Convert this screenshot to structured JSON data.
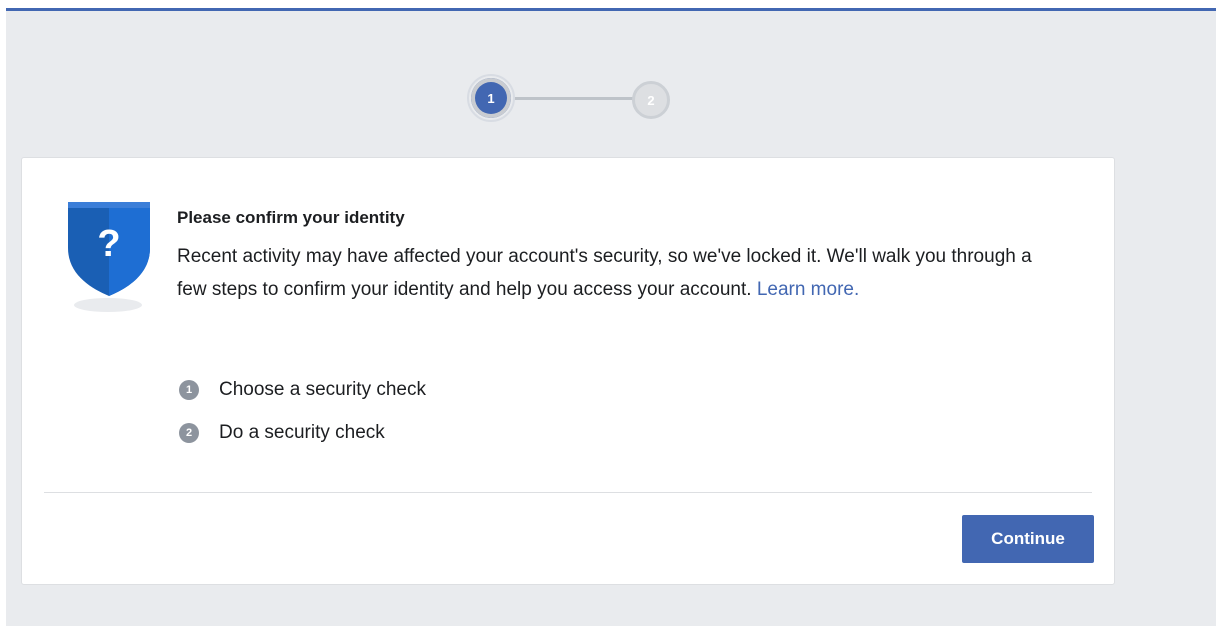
{
  "stepper": {
    "steps": [
      "1",
      "2"
    ],
    "current": 1
  },
  "card": {
    "icon": "shield-question-icon",
    "title": "Please confirm your identity",
    "description": "Recent activity may have affected your account's security, so we've locked it. We'll walk you through a few steps to confirm your identity and help you access your account.",
    "learn_more": "Learn more.",
    "steps": [
      {
        "number": "1",
        "label": "Choose a security check"
      },
      {
        "number": "2",
        "label": "Do a security check"
      }
    ],
    "continue_label": "Continue"
  },
  "colors": {
    "accent": "#4267b2",
    "background": "#e9ebee",
    "inactive": "#bec3c9",
    "badge": "#8d949e"
  }
}
